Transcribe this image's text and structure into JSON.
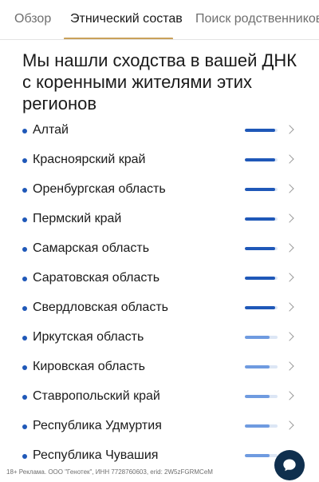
{
  "tabs": [
    {
      "label": "Обзор",
      "active": false
    },
    {
      "label": "Этнический состав",
      "active": true
    },
    {
      "label": "Поиск родственников",
      "active": false
    }
  ],
  "heading": "Мы нашли сходства в вашей ДНК с коренными жителями этих регионов",
  "colors": {
    "accent_tab": "#c9a15a",
    "bullet": "#1f58b8",
    "bar_strong": "#1f58b8",
    "bar_weak": "#6f9be0",
    "chat_button": "#0f2f4e"
  },
  "regions": [
    {
      "name": "Алтай",
      "level": 0.92,
      "strength": "strong"
    },
    {
      "name": "Красноярский край",
      "level": 0.92,
      "strength": "strong"
    },
    {
      "name": "Оренбургская область",
      "level": 0.92,
      "strength": "strong"
    },
    {
      "name": "Пермский край",
      "level": 0.92,
      "strength": "strong"
    },
    {
      "name": "Самарская область",
      "level": 0.92,
      "strength": "strong"
    },
    {
      "name": "Саратовская область",
      "level": 0.92,
      "strength": "strong"
    },
    {
      "name": "Свердловская область",
      "level": 0.92,
      "strength": "strong"
    },
    {
      "name": "Иркутская область",
      "level": 0.75,
      "strength": "weak"
    },
    {
      "name": "Кировская область",
      "level": 0.75,
      "strength": "weak"
    },
    {
      "name": "Ставропольский край",
      "level": 0.75,
      "strength": "weak"
    },
    {
      "name": "Республика Удмуртия",
      "level": 0.75,
      "strength": "weak"
    },
    {
      "name": "Республика Чувашия",
      "level": 0.75,
      "strength": "weak"
    }
  ],
  "footer": "18+ Реклама. ООО \"Генотек\", ИНН 7728760603, erid: 2W5zFGRMCeM",
  "icons": {
    "row_chevron": "chevron-right-icon",
    "chat": "chat-bubble-icon"
  }
}
